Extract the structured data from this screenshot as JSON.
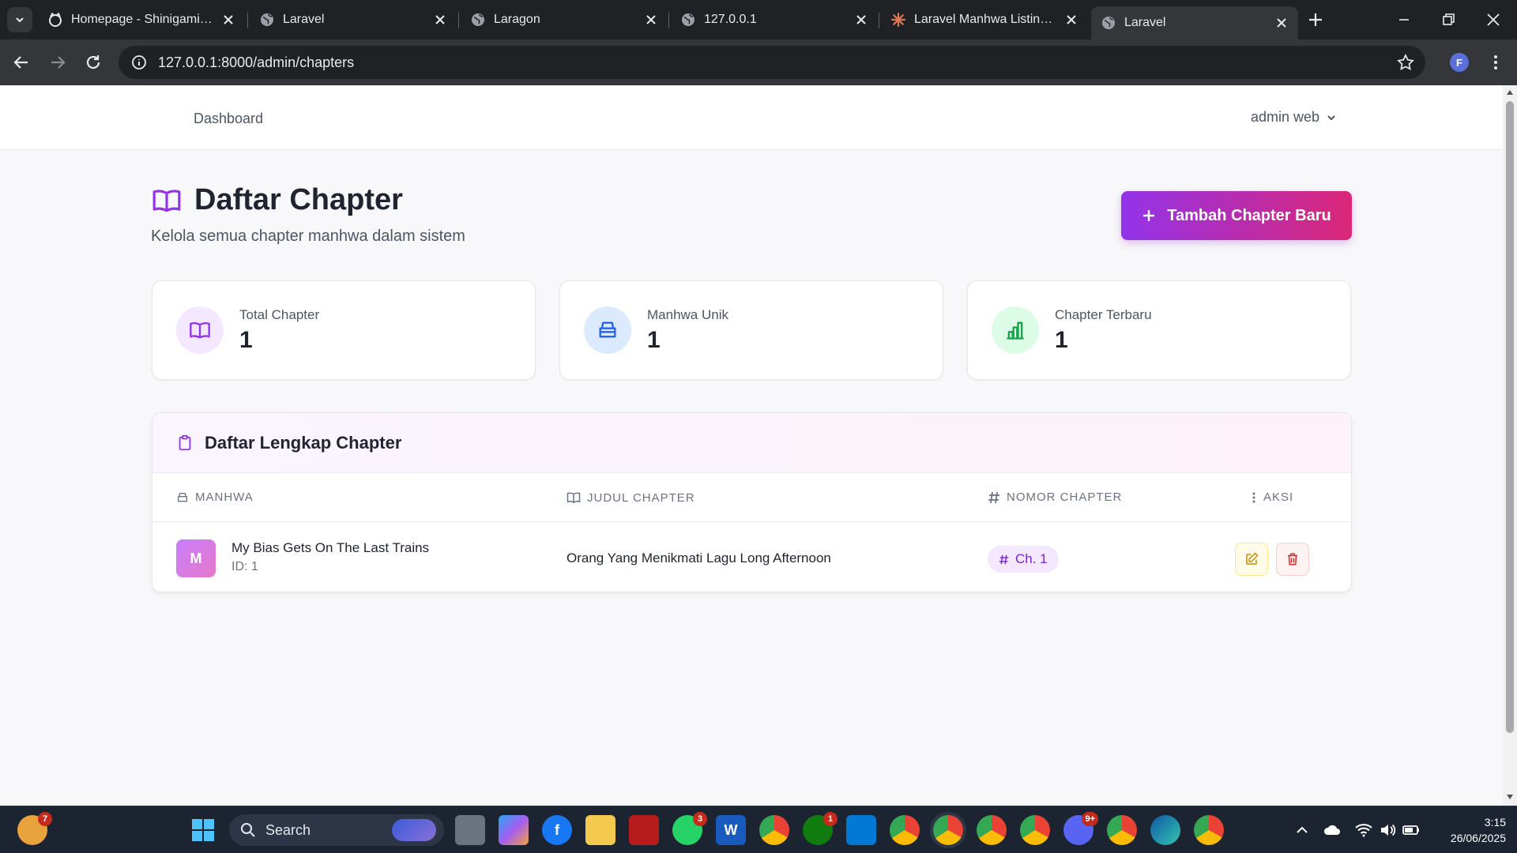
{
  "browser": {
    "tabs": [
      {
        "title": "Homepage - Shinigami Sca",
        "icon": "cat-icon"
      },
      {
        "title": "Laravel",
        "icon": "globe-icon"
      },
      {
        "title": "Laragon",
        "icon": "globe-icon"
      },
      {
        "title": "127.0.0.1",
        "icon": "globe-icon"
      },
      {
        "title": "Laravel Manhwa Listing Pa",
        "icon": "claude-icon"
      },
      {
        "title": "Laravel",
        "icon": "globe-icon",
        "active": true
      }
    ],
    "url": "127.0.0.1:8000/admin/chapters",
    "profile_initial": "F"
  },
  "nav": {
    "dashboard_label": "Dashboard",
    "user_label": "admin web"
  },
  "header": {
    "title": "Daftar Chapter",
    "subtitle": "Kelola semua chapter manhwa dalam sistem",
    "add_button_label": "Tambah Chapter Baru"
  },
  "stats": [
    {
      "label": "Total Chapter",
      "value": "1",
      "icon": "book-open-icon",
      "color": "#9333ea"
    },
    {
      "label": "Manhwa Unik",
      "value": "1",
      "icon": "archive-icon",
      "color": "#2563eb"
    },
    {
      "label": "Chapter Terbaru",
      "value": "1",
      "icon": "bar-chart-icon",
      "color": "#16a34a"
    }
  ],
  "table": {
    "title": "Daftar Lengkap Chapter",
    "columns": [
      "MANHWA",
      "JUDUL CHAPTER",
      "NOMOR CHAPTER",
      "AKSI"
    ],
    "rows": [
      {
        "avatar_letter": "M",
        "manhwa_title": "My Bias Gets On The Last Trains",
        "manhwa_id": "ID: 1",
        "chapter_title": "Orang Yang Menikmati Lagu Long Afternoon",
        "chapter_number": "Ch. 1"
      }
    ]
  },
  "taskbar": {
    "search_label": "Search",
    "time": "3:15",
    "date": "26/06/2025",
    "badges": {
      "widgets": "7",
      "whatsapp": "3",
      "xbox": "1",
      "discord": "9+"
    }
  },
  "colors": {
    "accent_purple": "#9333ea",
    "accent_pink": "#db2777",
    "edit_yellow": "#ca8a04",
    "delete_red": "#dc2626"
  }
}
